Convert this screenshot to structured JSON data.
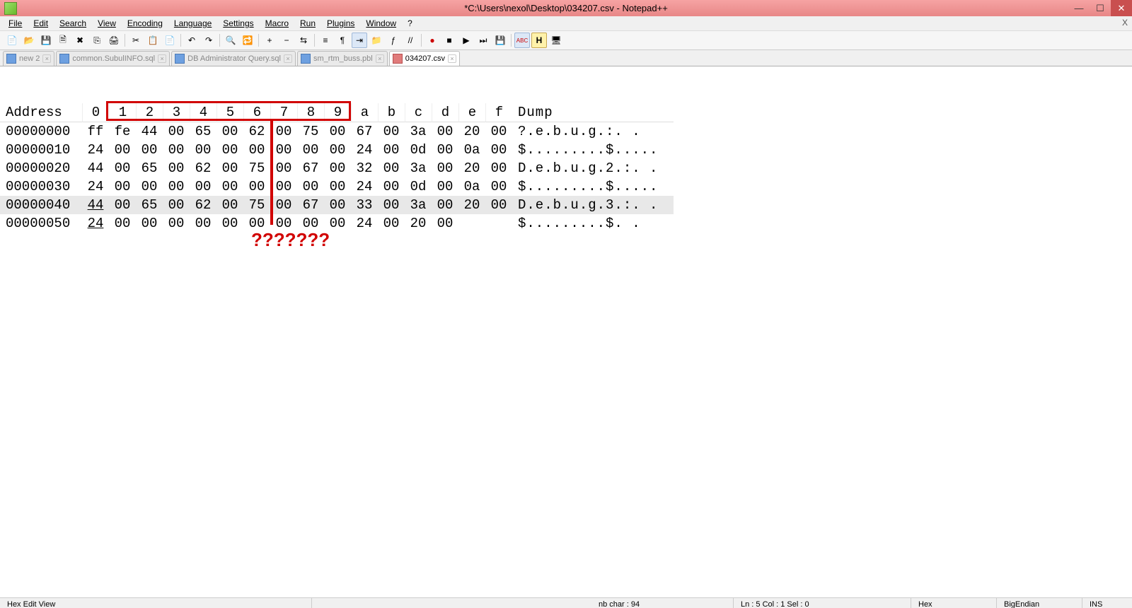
{
  "window": {
    "title": "*C:\\Users\\nexol\\Desktop\\034207.csv - Notepad++"
  },
  "menu": {
    "file": "File",
    "edit": "Edit",
    "search": "Search",
    "view": "View",
    "encoding": "Encoding",
    "language": "Language",
    "settings": "Settings",
    "macro": "Macro",
    "run": "Run",
    "plugins": "Plugins",
    "window": "Window",
    "help": "?"
  },
  "tabs": [
    {
      "label": "new  2"
    },
    {
      "label": "common.SubulINFO.sql"
    },
    {
      "label": "DB Administrator Query.sql"
    },
    {
      "label": "sm_rtm_buss.pbl"
    },
    {
      "label": "034207.csv"
    }
  ],
  "hex": {
    "header": [
      "Address",
      "0",
      "1",
      "2",
      "3",
      "4",
      "5",
      "6",
      "7",
      "8",
      "9",
      "a",
      "b",
      "c",
      "d",
      "e",
      "f",
      "Dump"
    ],
    "rows": [
      {
        "addr": "00000000",
        "b": [
          "ff",
          "fe",
          "44",
          "00",
          "65",
          "00",
          "62",
          "00",
          "75",
          "00",
          "67",
          "00",
          "3a",
          "00",
          "20",
          "00"
        ],
        "dump": "?.e.b.u.g.:. ."
      },
      {
        "addr": "00000010",
        "b": [
          "24",
          "00",
          "00",
          "00",
          "00",
          "00",
          "00",
          "00",
          "00",
          "00",
          "24",
          "00",
          "0d",
          "00",
          "0a",
          "00"
        ],
        "dump": "$.........$....."
      },
      {
        "addr": "00000020",
        "b": [
          "44",
          "00",
          "65",
          "00",
          "62",
          "00",
          "75",
          "00",
          "67",
          "00",
          "32",
          "00",
          "3a",
          "00",
          "20",
          "00"
        ],
        "dump": "D.e.b.u.g.2.:. ."
      },
      {
        "addr": "00000030",
        "b": [
          "24",
          "00",
          "00",
          "00",
          "00",
          "00",
          "00",
          "00",
          "00",
          "00",
          "24",
          "00",
          "0d",
          "00",
          "0a",
          "00"
        ],
        "dump": "$.........$....."
      },
      {
        "addr": "00000040",
        "b": [
          "44",
          "00",
          "65",
          "00",
          "62",
          "00",
          "75",
          "00",
          "67",
          "00",
          "33",
          "00",
          "3a",
          "00",
          "20",
          "00"
        ],
        "dump": "D.e.b.u.g.3.:. ."
      },
      {
        "addr": "00000050",
        "b": [
          "24",
          "00",
          "00",
          "00",
          "00",
          "00",
          "00",
          "00",
          "00",
          "00",
          "24",
          "00",
          "20",
          "00",
          "",
          ""
        ],
        "dump": "$.........$. ."
      }
    ]
  },
  "annotation": {
    "question": "???????"
  },
  "status": {
    "mode": "Hex Edit View",
    "nbchar": "nb char : 94",
    "pos": "Ln : 5   Col : 1   Sel : 0",
    "enc": "Hex",
    "endian": "BigEndian",
    "ins": "INS"
  },
  "icons": {
    "new": "📄",
    "open": "📂",
    "save": "💾",
    "saveall": "🗎",
    "close": "✖",
    "closeall": "⎘",
    "print": "🖨",
    "cut": "✂",
    "copy": "📋",
    "paste": "📄",
    "undo": "↶",
    "redo": "↷",
    "find": "🔍",
    "replace": "🔁",
    "zoomin": "+",
    "zoomout": "−",
    "sync": "⇆",
    "wrap": "≡",
    "allchars": "¶",
    "indent": "⇥",
    "folder": "📁",
    "func": "ƒ",
    "comment": "//",
    "record": "●",
    "stop": "■",
    "play": "▶",
    "playm": "⏭",
    "saverec": "💾",
    "book": "📖",
    "abc": "ABC",
    "h": "H",
    "monitor": "🖥"
  }
}
